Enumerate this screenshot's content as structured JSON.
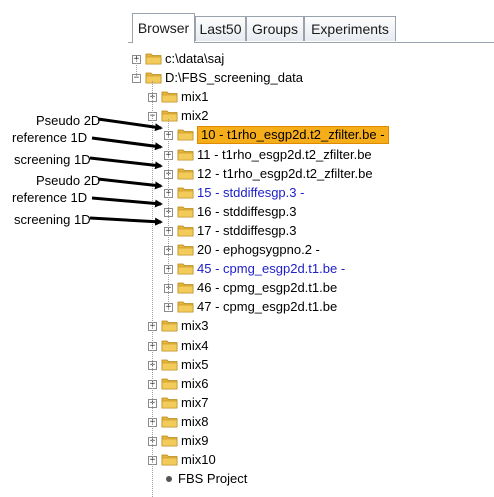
{
  "tabs": [
    {
      "label": "Browser",
      "active": true
    },
    {
      "label": "Last50",
      "active": false
    },
    {
      "label": "Groups",
      "active": false
    },
    {
      "label": "Experiments",
      "active": false
    }
  ],
  "tree": {
    "root1": "c:\\data\\saj",
    "root2": "D:\\FBS_screening_data",
    "mix1": "mix1",
    "mix2": "mix2",
    "mix2_children": [
      {
        "label": "10 - t1rho_esgp2d.t2_zfilter.be -",
        "color": "#000000",
        "selected": true
      },
      {
        "label": "11 - t1rho_esgp2d.t2_zfilter.be",
        "color": "#000000",
        "selected": false
      },
      {
        "label": "12 - t1rho_esgp2d.t2_zfilter.be",
        "color": "#000000",
        "selected": false
      },
      {
        "label": "15 - stddiffesgp.3 -",
        "color": "#2020c8",
        "selected": false
      },
      {
        "label": "16 - stddiffesgp.3",
        "color": "#000000",
        "selected": false
      },
      {
        "label": "17 - stddiffesgp.3",
        "color": "#000000",
        "selected": false
      },
      {
        "label": "20 - ephogsygpno.2 -",
        "color": "#000000",
        "selected": false
      },
      {
        "label": "45 - cpmg_esgp2d.t1.be -",
        "color": "#2020c8",
        "selected": false
      },
      {
        "label": "46 - cpmg_esgp2d.t1.be",
        "color": "#000000",
        "selected": false
      },
      {
        "label": "47 - cpmg_esgp2d.t1.be",
        "color": "#000000",
        "selected": false
      }
    ],
    "other_mixes": [
      "mix3",
      "mix4",
      "mix5",
      "mix6",
      "mix7",
      "mix8",
      "mix9",
      "mix10"
    ],
    "project": "FBS Project"
  },
  "annotations": [
    "Pseudo 2D",
    "reference 1D",
    "screening 1D",
    "Pseudo 2D",
    "reference 1D",
    "screening 1D"
  ],
  "colors": {
    "folder": "#e6b53a",
    "selection": "#f6ad1a",
    "blue_text": "#2020c8"
  },
  "icons": {
    "folder": "folder-icon",
    "expander": "expander-icon",
    "project": "bullet-icon"
  }
}
